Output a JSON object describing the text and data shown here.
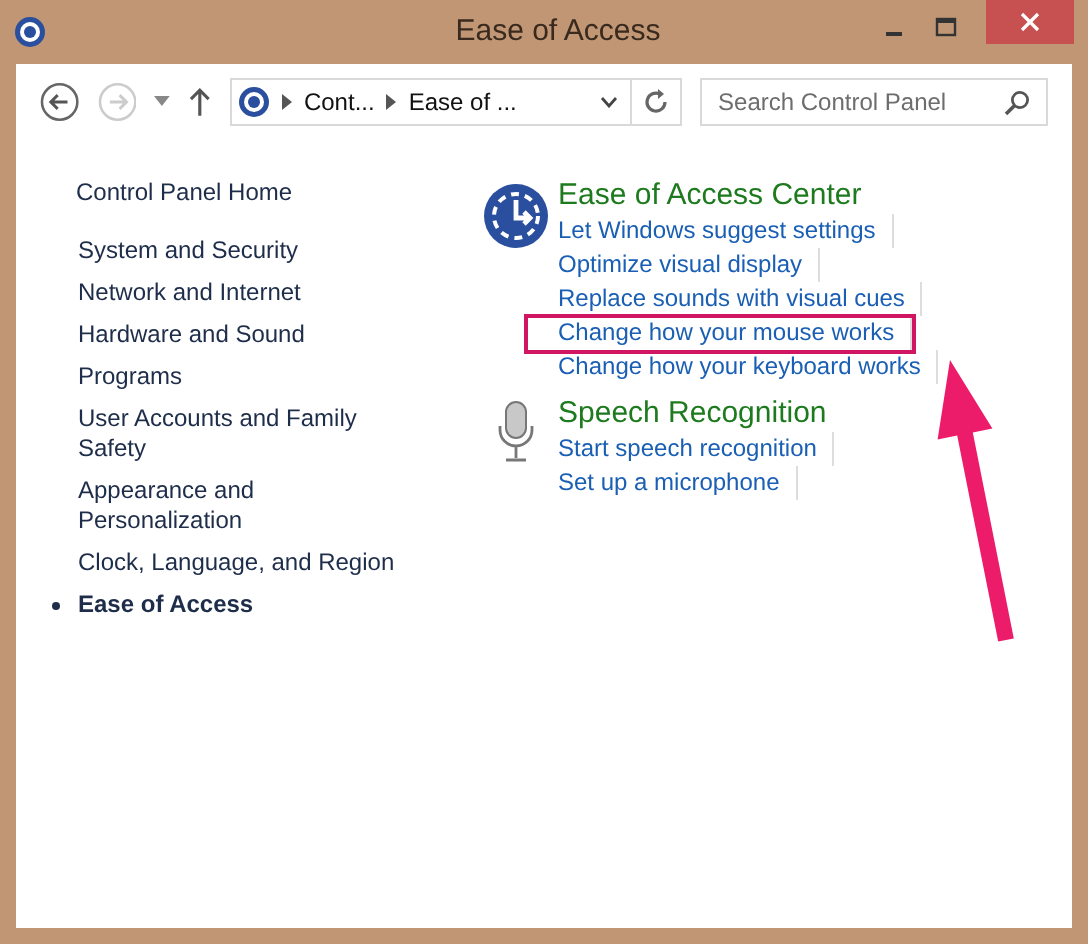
{
  "window": {
    "title": "Ease of Access"
  },
  "address_bar": {
    "crumbs": [
      "Cont...",
      "Ease of ..."
    ]
  },
  "search": {
    "placeholder": "Search Control Panel"
  },
  "sidebar": {
    "home": "Control Panel Home",
    "items": [
      {
        "label": "System and Security",
        "selected": false
      },
      {
        "label": "Network and Internet",
        "selected": false
      },
      {
        "label": "Hardware and Sound",
        "selected": false
      },
      {
        "label": "Programs",
        "selected": false
      },
      {
        "label": "User Accounts and Family Safety",
        "selected": false
      },
      {
        "label": "Appearance and Personalization",
        "selected": false
      },
      {
        "label": "Clock, Language, and Region",
        "selected": false
      },
      {
        "label": "Ease of Access",
        "selected": true
      }
    ]
  },
  "sections": [
    {
      "kind": "ease",
      "title": "Ease of Access Center",
      "links": [
        "Let Windows suggest settings",
        "Optimize visual display",
        "Replace sounds with visual cues",
        "Change how your mouse works",
        "Change how your keyboard works"
      ]
    },
    {
      "kind": "speech",
      "title": "Speech Recognition",
      "links": [
        "Start speech recognition",
        "Set up a microphone"
      ]
    }
  ]
}
